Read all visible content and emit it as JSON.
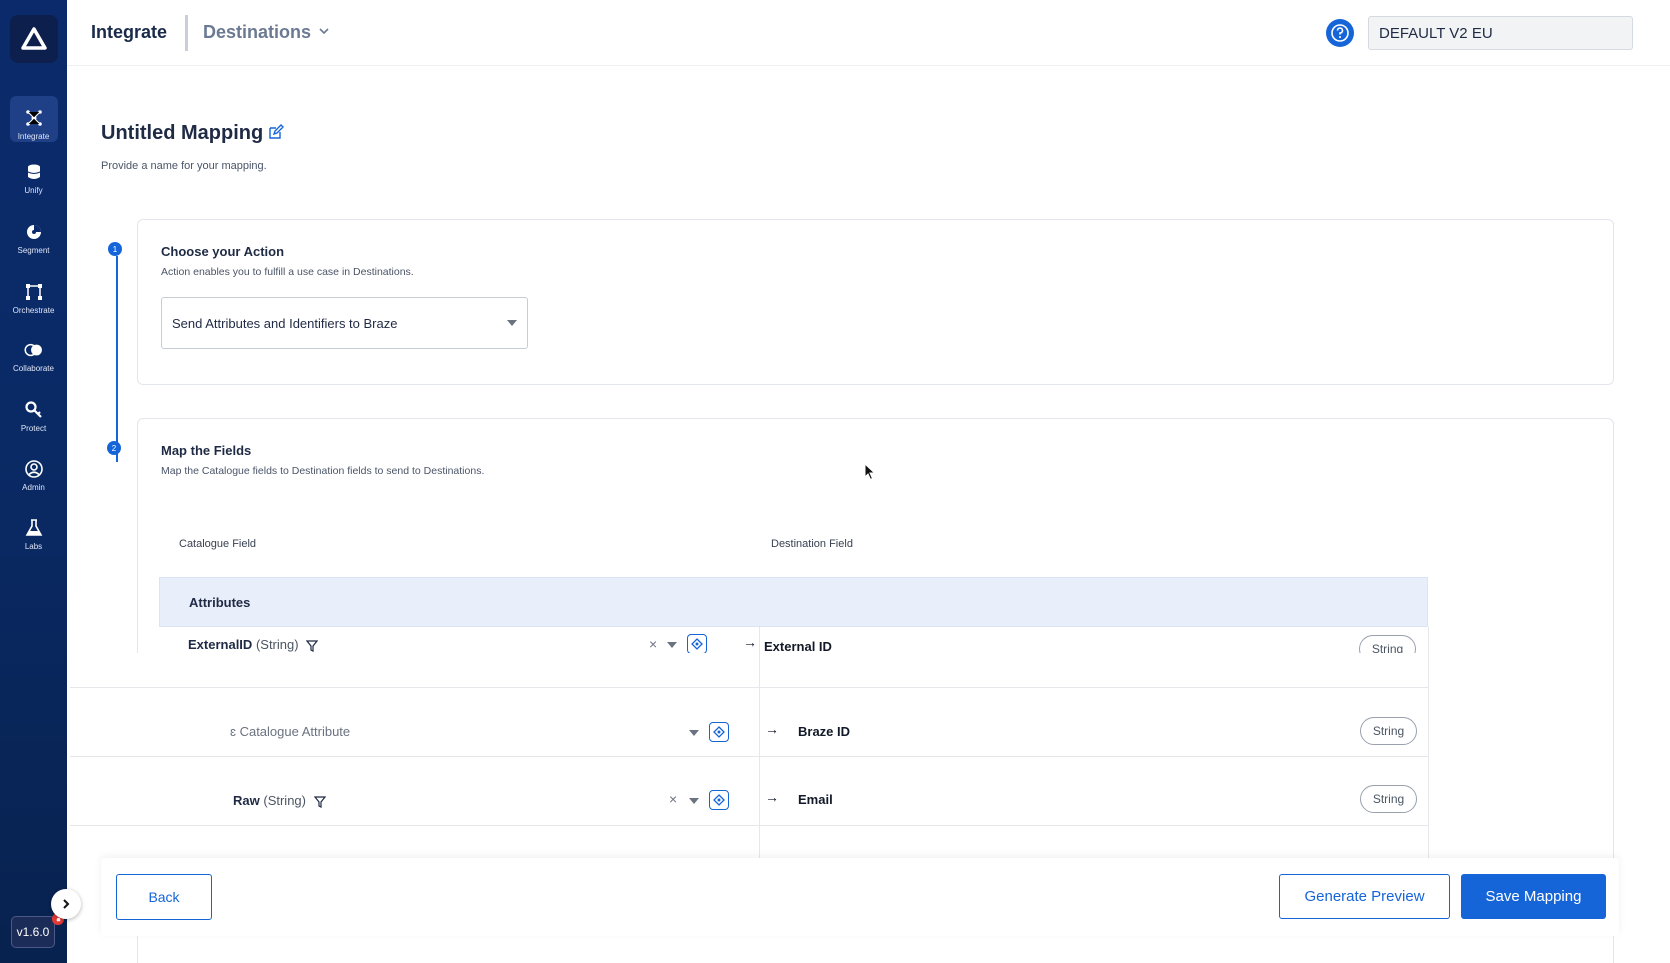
{
  "topbar": {
    "section": "Integrate",
    "subsection": "Destinations",
    "environment": "DEFAULT V2 EU"
  },
  "sidebar": {
    "items": [
      {
        "label": "Integrate",
        "icon": "integrate-icon"
      },
      {
        "label": "Unify",
        "icon": "database-icon"
      },
      {
        "label": "Segment",
        "icon": "segment-icon"
      },
      {
        "label": "Orchestrate",
        "icon": "orchestrate-icon"
      },
      {
        "label": "Collaborate",
        "icon": "collaborate-icon"
      },
      {
        "label": "Protect",
        "icon": "protect-icon"
      },
      {
        "label": "Admin",
        "icon": "admin-icon"
      },
      {
        "label": "Labs",
        "icon": "labs-icon"
      }
    ],
    "version": "v1.6.0"
  },
  "page": {
    "title": "Untitled Mapping",
    "subtitle": "Provide a name for your mapping."
  },
  "steps": [
    {
      "number": "1",
      "title": "Choose your Action",
      "description": "Action enables you to fulfill a use case in Destinations.",
      "selected_action": "Send Attributes and Identifiers to Braze"
    },
    {
      "number": "2",
      "title": "Map the Fields",
      "description": "Map the Catalogue fields to Destination fields to send to Destinations."
    }
  ],
  "mapping_table": {
    "columns": [
      "Catalogue Field",
      "Destination Field"
    ],
    "group": "Attributes",
    "rows": [
      {
        "catalogue_name": "ExternalID",
        "catalogue_type": "(String)",
        "destination": "External ID",
        "type": "String"
      },
      {
        "placeholder": "ɛ Catalogue Attribute",
        "destination": "Braze ID",
        "type": "String"
      },
      {
        "catalogue_name": "Raw",
        "catalogue_type": "(String)",
        "destination": "Email",
        "type": "String"
      }
    ]
  },
  "footer": {
    "back": "Back",
    "preview": "Generate Preview",
    "save": "Save Mapping"
  },
  "colors": {
    "accent": "#1565d8",
    "sidebar": "#0b2a6b",
    "group_bg": "#e8effb"
  }
}
